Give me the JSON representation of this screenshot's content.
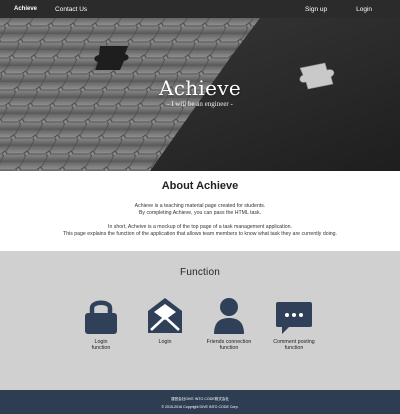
{
  "navbar": {
    "brand": "Achieve",
    "contact": "Contact Us",
    "signup": "Sign up",
    "login": "Login"
  },
  "hero": {
    "title": "Achieve",
    "subtitle": "- I will be an engineer -"
  },
  "about": {
    "title": "About Achieve",
    "paragraph1": [
      "Achieve is a teaching material page created for students.",
      "By completing Achieve, you can pass the HTML task."
    ],
    "paragraph2": [
      "In short, Acheive is a mockup of the top page of a task management application.",
      "This page explains the function of the application that allows team members to know what task they are currently doing."
    ]
  },
  "function": {
    "title": "Function",
    "items": [
      {
        "icon": "lock-icon",
        "label": [
          "Login",
          "function"
        ]
      },
      {
        "icon": "envelope-icon",
        "label": [
          "Login"
        ]
      },
      {
        "icon": "user-icon",
        "label": [
          "Friends connection",
          "function"
        ]
      },
      {
        "icon": "comment-icon",
        "label": [
          "Comment posting",
          "function"
        ]
      }
    ]
  },
  "footer": {
    "line1": "運営会社DIVE INTO CODE株式会社",
    "line2": "© 2015-2016 Copyright DIVE INTO CODE Corp."
  },
  "colors": {
    "navbar_bg": "#2b2b2b",
    "function_bg": "#d0d0d0",
    "icon": "#2f4058",
    "footer_bg": "#2e3e52"
  }
}
